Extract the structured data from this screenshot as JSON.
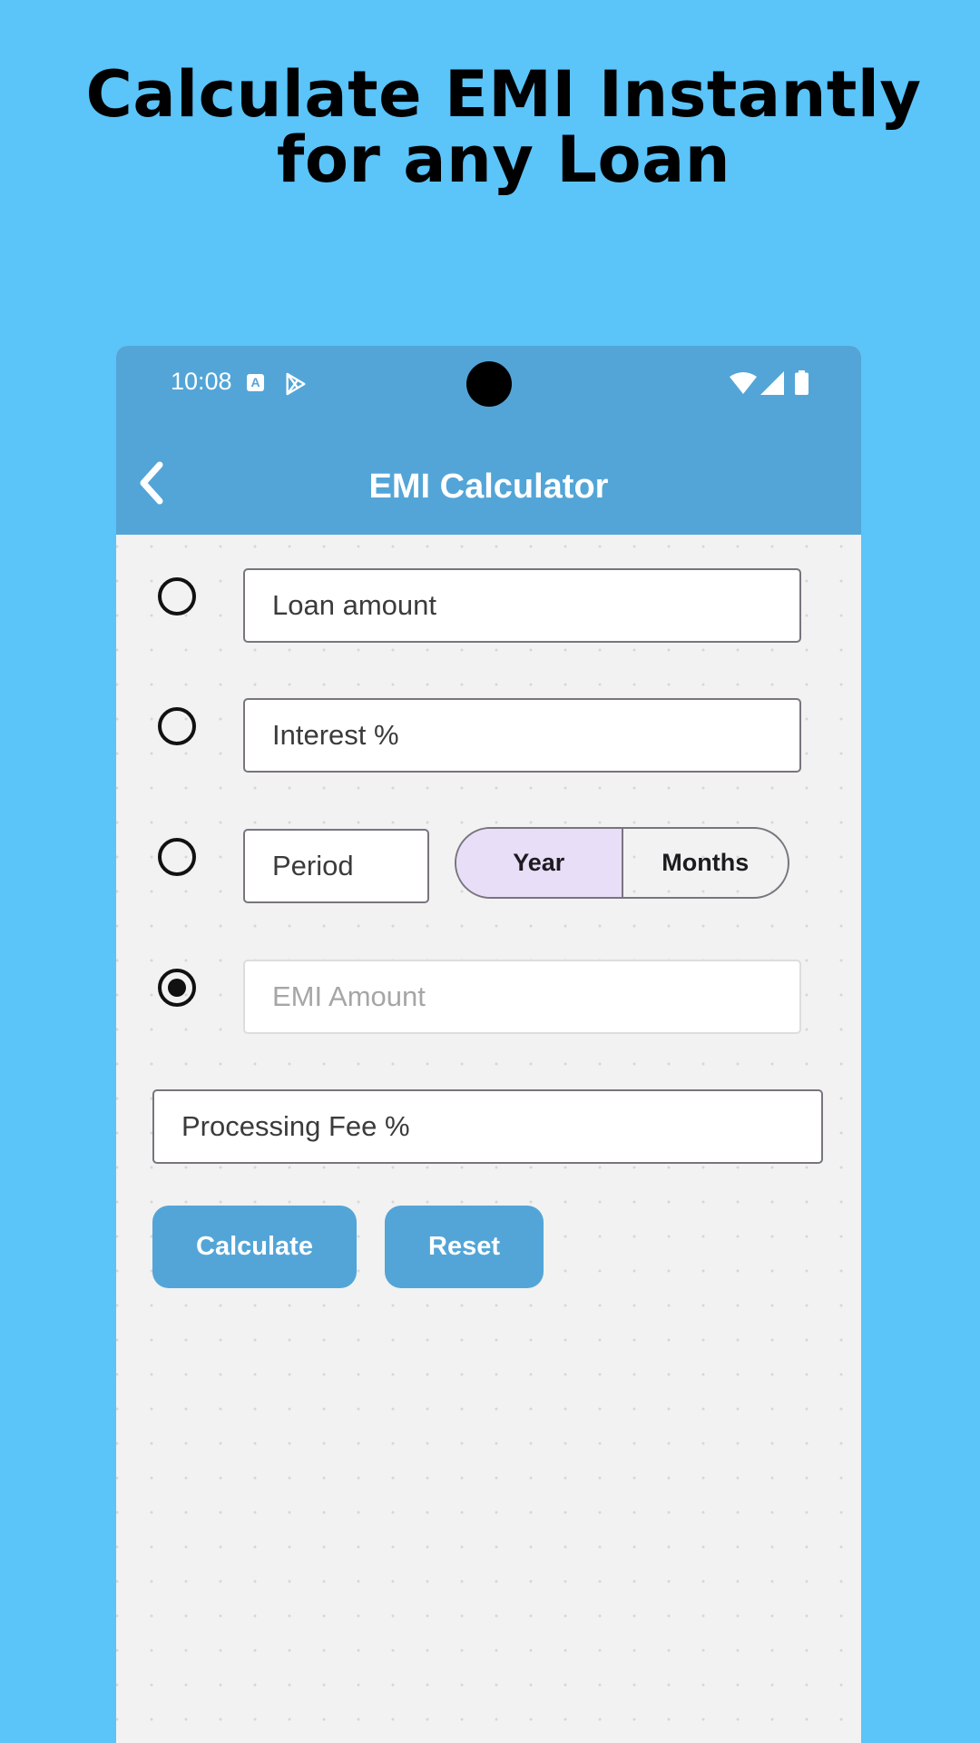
{
  "headline": "Calculate EMI Instantly for any Loan",
  "status_bar": {
    "time": "10:08",
    "notification_icon_letter": "A",
    "icons": [
      "play-store-icon",
      "wifi-icon",
      "signal-icon",
      "battery-icon"
    ]
  },
  "app_bar": {
    "title": "EMI Calculator",
    "back_icon": "chevron-left-icon"
  },
  "form": {
    "loan_amount": {
      "placeholder": "Loan amount",
      "value": "",
      "selected": false
    },
    "interest": {
      "placeholder": "Interest %",
      "value": "",
      "selected": false
    },
    "period": {
      "placeholder": "Period",
      "value": "",
      "selected": false,
      "units": [
        "Year",
        "Months"
      ],
      "selected_unit": "Year"
    },
    "emi_amount": {
      "placeholder": "EMI Amount",
      "value": "",
      "selected": true,
      "disabled": true
    },
    "processing_fee": {
      "placeholder": "Processing Fee %",
      "value": ""
    }
  },
  "buttons": {
    "calculate": "Calculate",
    "reset": "Reset"
  },
  "colors": {
    "page_background": "#5bc4f9",
    "app_bar": "#53a5d7",
    "button": "#53a5d7",
    "segment_selected": "#e8def8",
    "content_background": "#f1f2f1"
  }
}
